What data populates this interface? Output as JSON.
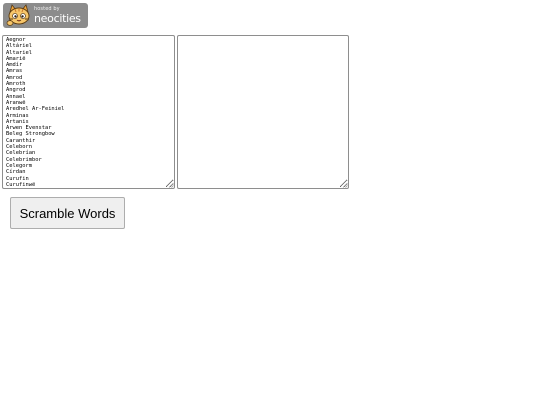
{
  "badge": {
    "hosted_by": "hosted by",
    "brand": "neocities",
    "icon": "neocities-cat-icon",
    "colors": {
      "background": "#8c8c8c",
      "text": "#ffffff"
    }
  },
  "input": {
    "value": "Aegnor\nAltáriel\nAltariel\nAmarië\nAmdír\nAmras\nAmrod\nAmroth\nAngrod\nAnnael\nAranwë\nAredhel Ar-Feiniel\nArminas\nArtanis\nArwen Evenstar\nBeleg Strongbow\nCaranthir\nCeleborn\nCelebrían\nCelebrimbor\nCelegorm\nCírdan\nCurufin\nCurufinwë"
  },
  "output": {
    "value": ""
  },
  "scramble_button": {
    "label": "Scramble Words"
  }
}
